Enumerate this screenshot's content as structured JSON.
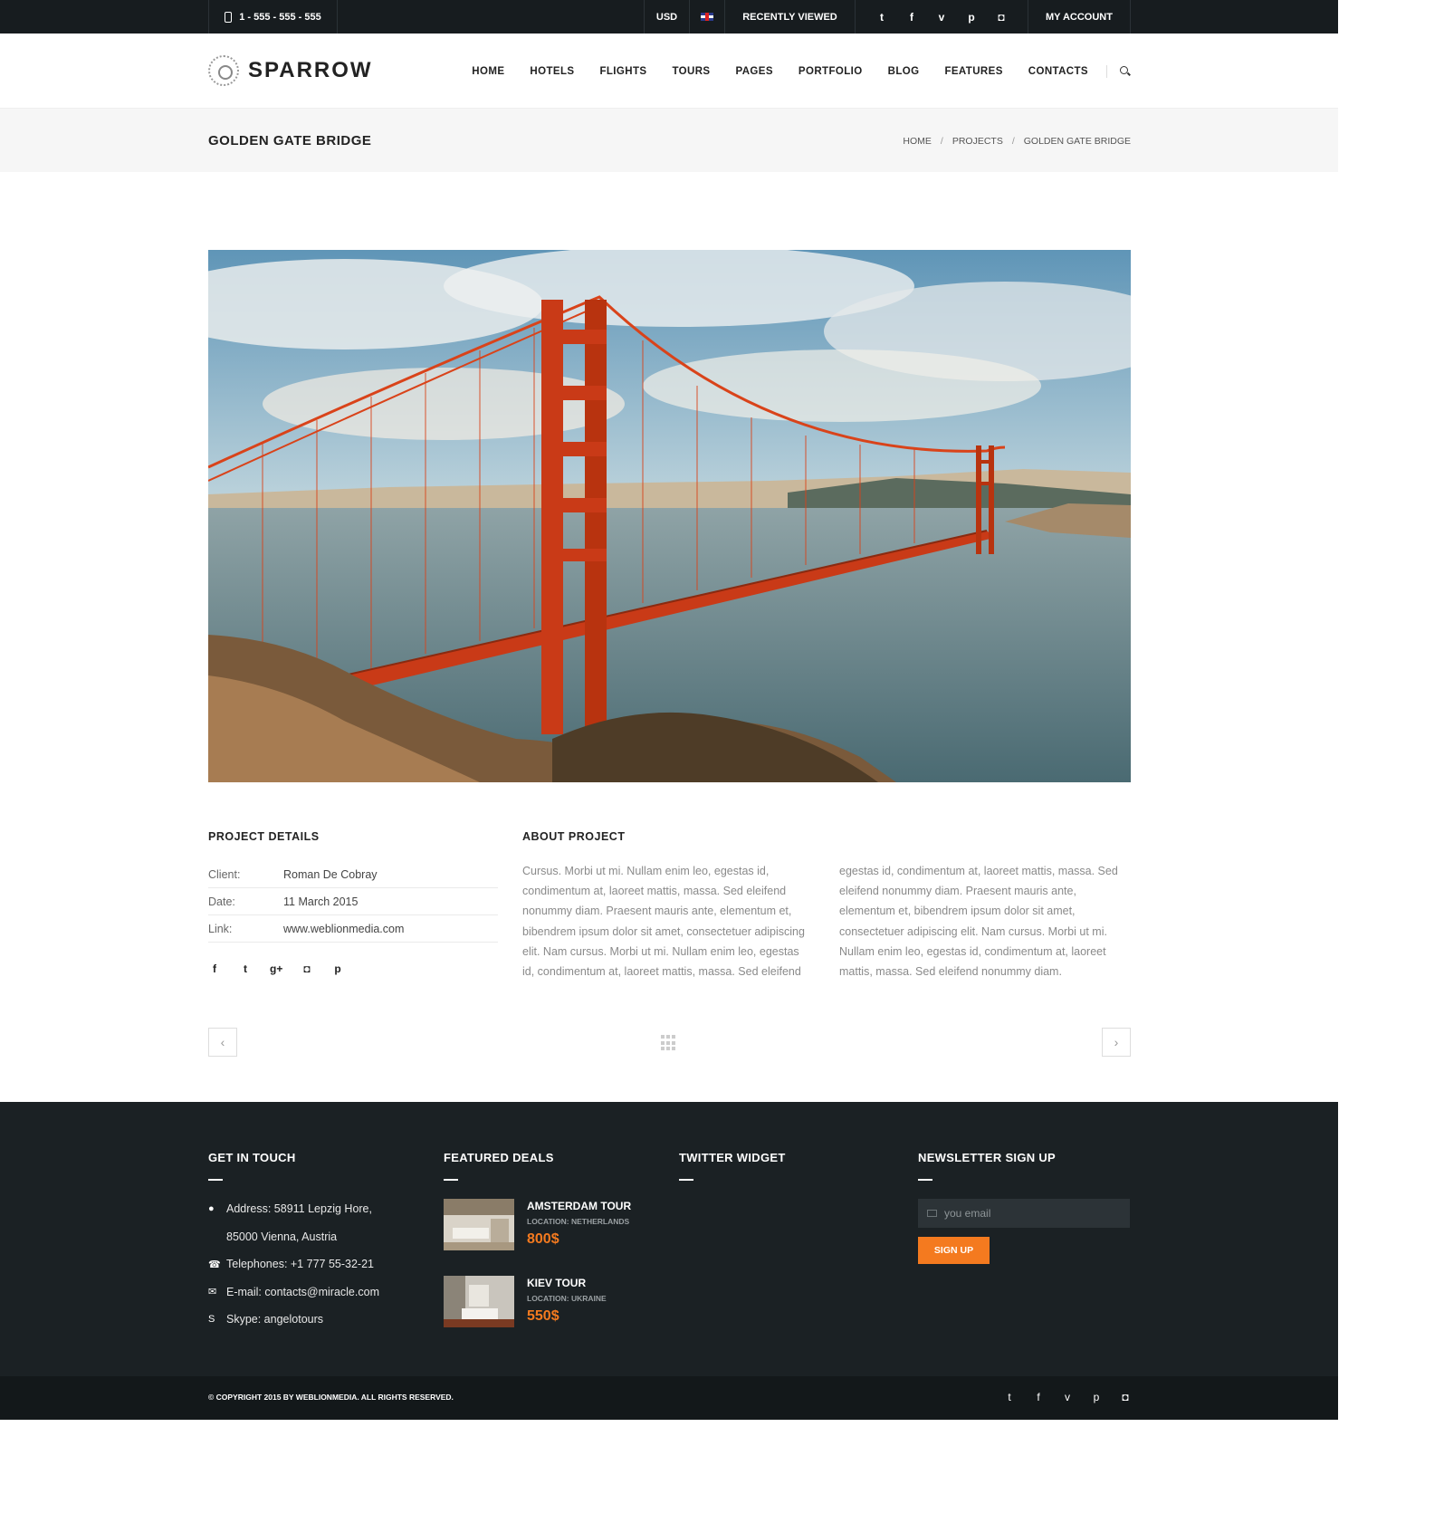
{
  "topbar": {
    "phone": "1 - 555 - 555 - 555",
    "currency": "USD",
    "recently_viewed": "RECENTLY VIEWED",
    "account": "MY ACCOUNT",
    "social": [
      "twitter-icon",
      "facebook-icon",
      "vimeo-icon",
      "pinterest-icon",
      "instagram-icon"
    ]
  },
  "header": {
    "logo": "SPARROW",
    "nav": [
      "HOME",
      "HOTELS",
      "FLIGHTS",
      "TOURS",
      "PAGES",
      "PORTFOLIO",
      "BLOG",
      "FEATURES",
      "CONTACTS"
    ]
  },
  "titlebar": {
    "title": "GOLDEN GATE BRIDGE",
    "breadcrumb": [
      "HOME",
      "PROJECTS",
      "GOLDEN GATE BRIDGE"
    ]
  },
  "project": {
    "details_heading": "PROJECT DETAILS",
    "rows": [
      {
        "label": "Client:",
        "value": "Roman De Cobray"
      },
      {
        "label": "Date:",
        "value": "11 March 2015"
      },
      {
        "label": "Link:",
        "value": "www.weblionmedia.com"
      }
    ],
    "share_icons": [
      "facebook-icon",
      "twitter-icon",
      "google-plus-icon",
      "instagram-icon",
      "pinterest-icon"
    ],
    "about_heading": "ABOUT PROJECT",
    "about_col1": "Cursus. Morbi ut mi. Nullam enim leo, egestas id, condimentum at, laoreet mattis, massa. Sed eleifend nonummy diam. Praesent mauris ante, elementum et, bibendrem ipsum dolor sit amet, consectetuer adipiscing elit. Nam cursus. Morbi ut mi. Nullam enim leo, egestas id, condimentum at, laoreet mattis, massa. Sed eleifend",
    "about_col2": "egestas id, condimentum at, laoreet mattis, massa. Sed eleifend nonummy diam. Praesent mauris ante, elementum et, bibendrem ipsum dolor sit amet, consectetuer adipiscing elit. Nam cursus. Morbi ut mi. Nullam enim leo, egestas id, condimentum at, laoreet mattis, massa. Sed eleifend nonummy diam."
  },
  "footer": {
    "contact_heading": "GET IN TOUCH",
    "contact": {
      "address1": "Address: 58911 Lepzig Hore,",
      "address2": "85000 Vienna, Austria",
      "telephone": "Telephones: +1 777 55-32-21",
      "email": "E-mail: contacts@miracle.com",
      "skype": "Skype: angelotours"
    },
    "deals_heading": "FEATURED DEALS",
    "deals": [
      {
        "title": "AMSTERDAM TOUR",
        "location": "LOCATION: NETHERLANDS",
        "price": "800$"
      },
      {
        "title": "KIEV TOUR",
        "location": "LOCATION: UKRAINE",
        "price": "550$"
      }
    ],
    "twitter_heading": "TWITTER WIDGET",
    "newsletter_heading": "NEWSLETTER SIGN UP",
    "newsletter_placeholder": "you email",
    "signup_label": "SIGN UP",
    "copyright": "© COPYRIGHT 2015 BY WEBLIONMEDIA. ALL RIGHTS RESERVED.",
    "social": [
      "twitter-icon",
      "facebook-icon",
      "vimeo-icon",
      "pinterest-icon",
      "instagram-icon"
    ]
  },
  "colors": {
    "accent": "#f47a1f",
    "topbar_bg": "#171c1f",
    "footer_bg": "#1b2124",
    "bottombar_bg": "#13181a"
  }
}
